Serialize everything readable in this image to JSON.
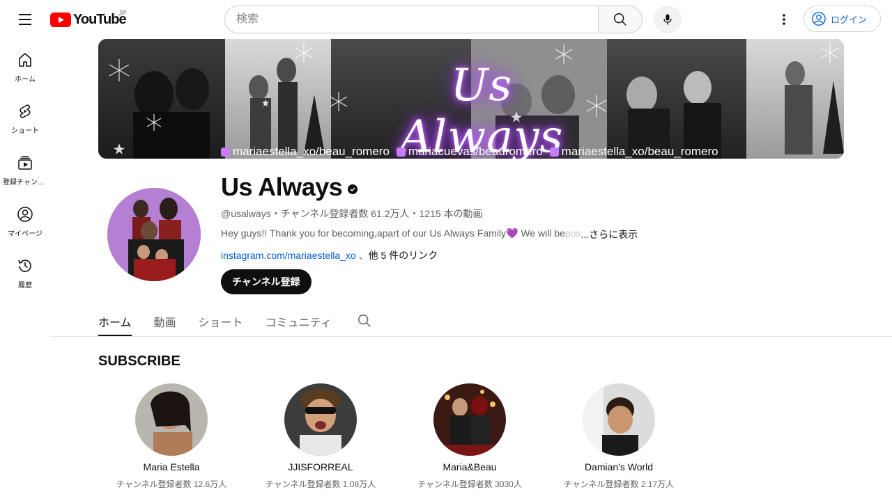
{
  "header": {
    "logo_text": "YouTube",
    "region": "JP",
    "search_placeholder": "検索",
    "login_label": "ログイン"
  },
  "sidebar": {
    "items": [
      {
        "label": "ホーム",
        "icon": "home-icon"
      },
      {
        "label": "ショート",
        "icon": "shorts-icon"
      },
      {
        "label": "登録チャンネル",
        "icon": "subscriptions-icon"
      },
      {
        "label": "マイページ",
        "icon": "you-icon"
      },
      {
        "label": "履歴",
        "icon": "history-icon"
      }
    ]
  },
  "banner": {
    "title": "Us Always",
    "handles": [
      "mariaestella_xo/beau_romero",
      "mariacuevas/beauromero",
      "mariaestella_xo/beau_romero"
    ]
  },
  "channel": {
    "name": "Us Always",
    "meta": "@usalways・チャンネル登録者数 61.2万人・1215 本の動画",
    "description": "Hey guys!! Thank you for becoming,apart of our Us Always Family💜  We will be",
    "description_fade": " pos",
    "more_label": "...さらに表示",
    "link": "instagram.com/mariaestella_xo",
    "link_separator": " 、",
    "other_links": "他 5 件のリンク",
    "subscribe_label": "チャンネル登録"
  },
  "tabs": [
    "ホーム",
    "動画",
    "ショート",
    "コミュニティ"
  ],
  "subscribe_section": {
    "title": "SUBSCRIBE",
    "channels": [
      {
        "name": "Maria Estella",
        "subs": "チャンネル登録者数 12.6万人"
      },
      {
        "name": "JJISFORREAL",
        "subs": "チャンネル登録者数 1.08万人"
      },
      {
        "name": "Maria&Beau",
        "subs": "チャンネル登録者数 3030人"
      },
      {
        "name": "Damian's World",
        "subs": "チャンネル登録者数 2.17万人"
      }
    ]
  },
  "colors": {
    "brand_red": "#ff0000",
    "link_blue": "#065fd4",
    "neon_purple": "#a640ff"
  }
}
